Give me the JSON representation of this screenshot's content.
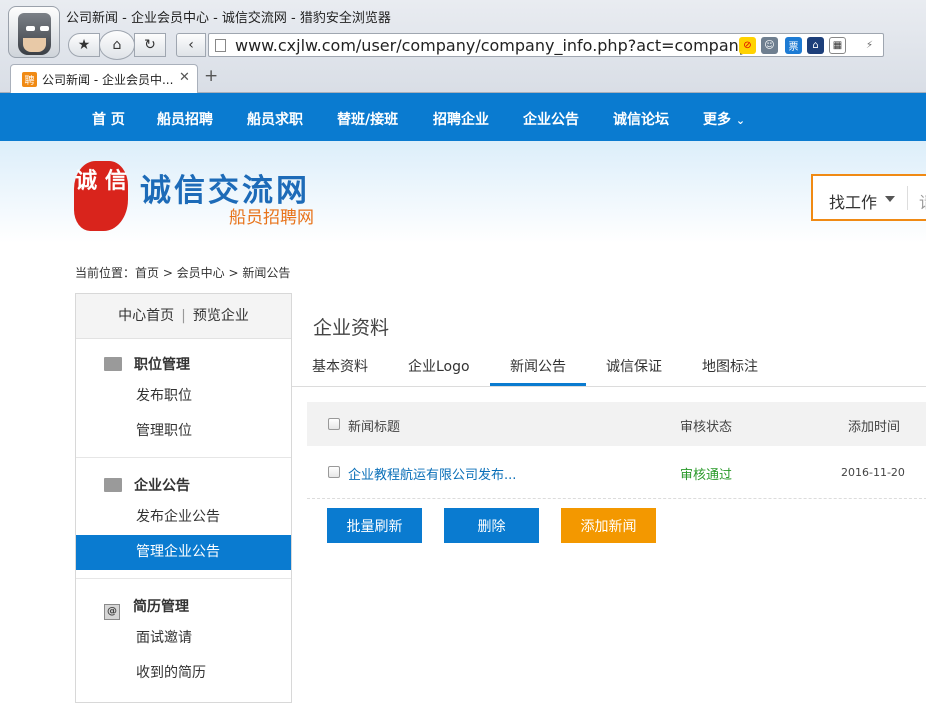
{
  "browser": {
    "window_title": "公司新闻 - 企业会员中心 - 诚信交流网 - 猎豹安全浏览器",
    "url": "www.cxjlw.com/user/company/company_info.php?act=company_new",
    "tab_title": "公司新闻 - 企业会员中...",
    "tab_favicon": "聘",
    "ext_ticket": "票"
  },
  "nav": {
    "items": [
      "首 页",
      "船员招聘",
      "船员求职",
      "替班/接班",
      "招聘企业",
      "企业公告",
      "诚信论坛"
    ],
    "more": "更多"
  },
  "header": {
    "seal_text": "诚 信",
    "logo_main": "诚信交流网",
    "logo_sub": "船员招聘网",
    "search_select": "找工作",
    "search_placeholder_partial": "请"
  },
  "breadcrumb": "当前位置：首页 > 会员中心 > 新闻公告",
  "sidebar": {
    "top_links": [
      "中心首页",
      "预览企业"
    ],
    "groups": [
      {
        "title": "职位管理",
        "links": [
          "发布职位",
          "管理职位"
        ]
      },
      {
        "title": "企业公告",
        "links": [
          "发布企业公告",
          "管理企业公告"
        ]
      },
      {
        "title": "简历管理",
        "links": [
          "面试邀请",
          "收到的简历"
        ]
      }
    ],
    "active_link": "管理企业公告"
  },
  "main": {
    "title": "企业资料",
    "tabs": [
      "基本资料",
      "企业Logo",
      "新闻公告",
      "诚信保证",
      "地图标注"
    ],
    "active_tab": "新闻公告",
    "table": {
      "headers": [
        "新闻标题",
        "审核状态",
        "添加时间"
      ],
      "rows": [
        {
          "title": "企业教程航运有限公司发布...",
          "status": "审核通过",
          "date": "2016-11-20"
        }
      ]
    },
    "buttons": {
      "batch_refresh": "批量刷新",
      "delete": "删除",
      "add_news": "添加新闻"
    }
  },
  "colors": {
    "primary": "#0a7bd0",
    "accent": "#f39800",
    "status_ok": "#2a9a2a"
  }
}
